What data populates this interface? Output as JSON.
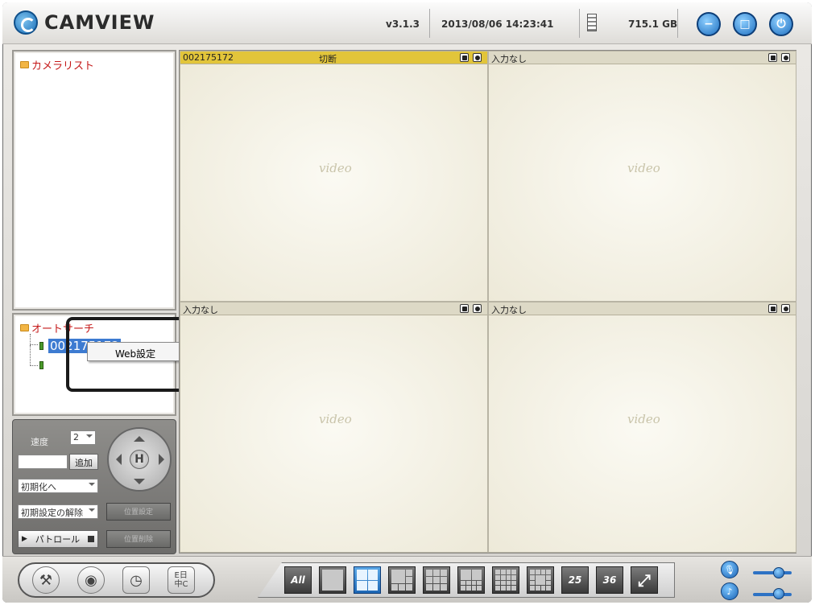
{
  "app": {
    "name": "CAMVIEW",
    "version": "v3.1.3",
    "datetime": "2013/08/06 14:23:41",
    "disk_free": "715.1 GB"
  },
  "header_buttons": [
    {
      "icon": "minimize-icon"
    },
    {
      "icon": "maximize-icon"
    },
    {
      "icon": "power-icon"
    }
  ],
  "camera_list": {
    "title": "カメラリスト"
  },
  "auto_search": {
    "title": "オートサーチ",
    "items": [
      {
        "label": "002175172",
        "selected": true
      },
      {
        "label": ""
      }
    ]
  },
  "context_menu": {
    "items": [
      "Web設定"
    ]
  },
  "ptz": {
    "speed_label": "速度",
    "speed_value": "2",
    "add_button": "追加",
    "preset_select": "初期化へ",
    "preset_reset_select": "初期設定の解除",
    "patrol_button": "パトロール",
    "button_a": "位置設定",
    "button_b": "位置削除",
    "home_label": "H"
  },
  "video_cells": [
    {
      "name": "002175172",
      "status": "切断",
      "active": true,
      "watermark": "video"
    },
    {
      "name": "入力なし",
      "status": "",
      "active": false,
      "watermark": "video"
    },
    {
      "name": "入力なし",
      "status": "",
      "active": false,
      "watermark": "video"
    },
    {
      "name": "入力なし",
      "status": "",
      "active": false,
      "watermark": "video"
    }
  ],
  "layout_buttons": [
    {
      "label": "All",
      "icon": "all-layout-icon"
    },
    {
      "icon": "layout-1-icon"
    },
    {
      "icon": "layout-4-icon",
      "selected": true
    },
    {
      "icon": "layout-6-icon"
    },
    {
      "icon": "layout-9-icon"
    },
    {
      "icon": "layout-10-icon"
    },
    {
      "icon": "layout-16-icon"
    },
    {
      "icon": "layout-13-icon"
    },
    {
      "label": "25",
      "icon": "layout-25-icon"
    },
    {
      "label": "36",
      "icon": "layout-36-icon"
    },
    {
      "icon": "fullscreen-icon"
    }
  ],
  "toolbar_labels": {
    "language_btn": "E日\n中C"
  }
}
